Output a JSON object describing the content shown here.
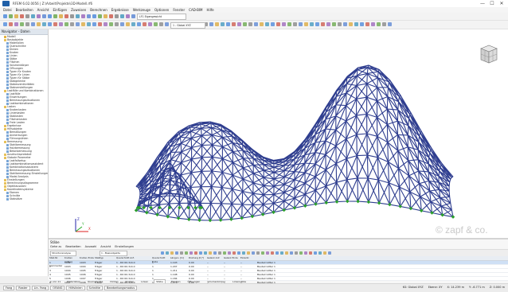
{
  "app": {
    "title": "RFEM 6.02.0056 | Z:\\Arbeit\\Projekte\\3D-Modell.rf6",
    "window_controls": [
      "—",
      "☐",
      "✕"
    ]
  },
  "menu": [
    "Datei",
    "Bearbeiten",
    "Ansicht",
    "Einfügen",
    "Zuweisen",
    "Berechnen",
    "Ergebnisse",
    "Werkzeuge",
    "Optionen",
    "Fenster",
    "CAD-BIM",
    "Hilfe"
  ],
  "toolbar": {
    "load_case": "LF1 Eigengewicht",
    "view_combo": "1 - Global XYZ"
  },
  "navigator": {
    "title": "Navigator - Daten",
    "items": [
      "Modell",
      "Basisobjekte",
      "Materialien",
      "Querschnitte",
      "Dicken",
      "Knoten",
      "Linien",
      "Stäbe",
      "Flächen",
      "Volumenkörper",
      "Öffnungen",
      "Typen für Knoten",
      "Typen für Linien",
      "Typen für Stäbe",
      "Stabgelenke",
      "Stabexzentrizitäten",
      "Stabversteifungen",
      "Lastfälle und Kombinationen",
      "Lastfälle",
      "Einwirkungen",
      "Bemessungssituationen",
      "Lastkombinationen",
      "Lasten",
      "Knotenlasten",
      "Linienlasten",
      "Stablasten",
      "Flächenlasten",
      "Freie Lasten",
      "Ergebnisse",
      "Hilfsobjekte",
      "Bemaßungen",
      "Anmerkungen",
      "Führungslinien",
      "Bemessung",
      "Stahlbemessung",
      "Holzbemessung",
      "Betonbemessung",
      "Ausdrucksprotokoll",
      "Globale Parameter",
      "Lastfallsetup",
      "Lastkombinationsassistent",
      "Kombinationsassistent",
      "Bemessungssituationen",
      "Stahlbemessung Einstellungen",
      "Modal Analysis",
      "Einstellungen",
      "Berechnungsdiagramme",
      "Objektauswahl",
      "Koordinatensysteme",
      "Ebenen",
      "Schnitte",
      "Stabsätze"
    ]
  },
  "viewport": {
    "watermark": "© zapf & co.",
    "axis": {
      "x": "X",
      "y": "Y",
      "z": "Z"
    },
    "colors": {
      "members": "#2e3d8f",
      "supports": "#2aa02a",
      "background": "#ffffff"
    }
  },
  "table": {
    "title": "Stäbe",
    "menu": [
      "Gehe zu",
      "Bearbeiten",
      "Auswahl",
      "Ansicht",
      "Einstellungen"
    ],
    "tb_combo": "Strukturanalyse",
    "tb_combo2": "1 - Basisobjekte",
    "columns": [
      "Stab Nr.",
      "Knoten Anfang",
      "Knoten Ende",
      "Stabtyp",
      "Querschnitt Anf.",
      "Querschnitt Ende",
      "Länge L [m]",
      "Drehung β [°]",
      "Gelenk Anf.",
      "Gelenk Ende",
      "Exzentr.",
      "Kommentar"
    ],
    "rows": [
      [
        "1",
        "1002",
        "1003",
        "Träger",
        "1 - RO 60.3x4.0",
        "1",
        "1.193",
        "0.00",
        "--",
        "--",
        "--",
        "Bauteil Gitter 1"
      ],
      [
        "2",
        "1003",
        "1004",
        "Träger",
        "1 - RO 60.3x4.0",
        "1",
        "1.207",
        "0.00",
        "--",
        "--",
        "--",
        "Bauteil Gitter 1"
      ],
      [
        "3",
        "1004",
        "1005",
        "Träger",
        "1 - RO 60.3x4.0",
        "1",
        "1.211",
        "0.00",
        "--",
        "--",
        "--",
        "Bauteil Gitter 1"
      ],
      [
        "4",
        "1005",
        "1006",
        "Träger",
        "1 - RO 60.3x4.0",
        "1",
        "1.198",
        "0.00",
        "--",
        "--",
        "--",
        "Bauteil Gitter 1"
      ],
      [
        "5",
        "1006",
        "1007",
        "Träger",
        "1 - RO 60.3x4.0",
        "1",
        "1.184",
        "0.00",
        "--",
        "--",
        "--",
        "Bauteil Gitter 1"
      ],
      [
        "6",
        "1007",
        "1008",
        "Träger",
        "1 - RO 60.3x4.0",
        "1",
        "1.176",
        "0.00",
        "--",
        "--",
        "--",
        "Bauteil Gitter 1"
      ]
    ],
    "tabs": [
      "Materialien",
      "Querschnitte",
      "Dicken",
      "Knoten",
      "Linien",
      "Stäbe",
      "Flächen",
      "Öffnungen",
      "Volumenkörper",
      "Liniensätze"
    ],
    "pager": "1 von 11"
  },
  "status": {
    "left": [
      "Fang",
      "Raster",
      "Lin. Fang",
      "OFANG",
      "Hilfslinien",
      "Schnitte",
      "Bearbeitungsmodus"
    ],
    "right": [
      "KS: Global XYZ",
      "Ebene: XY",
      "X: 14.239 m",
      "Y: -6.771 m",
      "Z: 0.000 m"
    ]
  }
}
